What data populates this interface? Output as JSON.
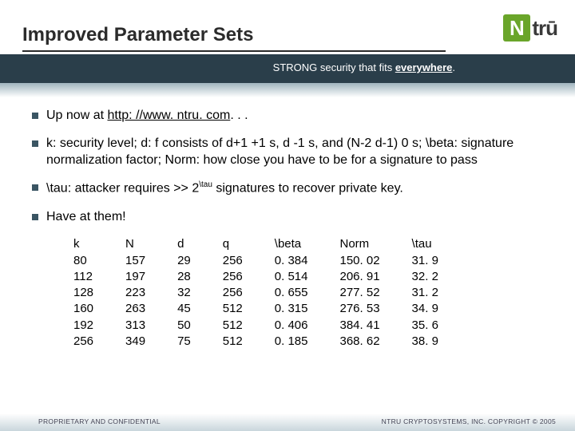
{
  "header": {
    "title": "Improved Parameter Sets",
    "tagline_pre": "STRONG security that fits ",
    "tagline_emph": "everywhere",
    "tagline_post": "."
  },
  "logo": {
    "mark": "N",
    "text": "trū"
  },
  "bullets": {
    "b1_pre": "Up now at ",
    "b1_link": "http: //www. ntru. com",
    "b1_post": ". . .",
    "b2": "k: security level; d: f consists of d+1 +1 s, d -1 s, and (N-2 d-1) 0 s; \\beta: signature normalization factor; Norm: how close you have to be for a signature to pass",
    "b3_pre": "\\tau: attacker requires >> 2",
    "b3_sup": "\\tau",
    "b3_post": " signatures to recover private key.",
    "b4": "Have at them!"
  },
  "table": {
    "headers": [
      "k",
      "N",
      "d",
      "q",
      "\\beta",
      "Norm",
      "\\tau"
    ],
    "rows": [
      [
        "80",
        "157",
        "29",
        "256",
        "0. 384",
        "150. 02",
        "31. 9"
      ],
      [
        "112",
        "197",
        "28",
        "256",
        "0. 514",
        "206. 91",
        "32. 2"
      ],
      [
        "128",
        "223",
        "32",
        "256",
        "0. 655",
        "277. 52",
        "31. 2"
      ],
      [
        "160",
        "263",
        "45",
        "512",
        "0. 315",
        "276. 53",
        "34. 9"
      ],
      [
        "192",
        "313",
        "50",
        "512",
        "0. 406",
        "384. 41",
        "35. 6"
      ],
      [
        "256",
        "349",
        "75",
        "512",
        "0. 185",
        "368. 62",
        "38. 9"
      ]
    ]
  },
  "footer": {
    "left": "PROPRIETARY AND CONFIDENTIAL",
    "right": "NTRU CRYPTOSYSTEMS, INC. COPYRIGHT © 2005"
  },
  "chart_data": {
    "type": "table",
    "title": "Improved Parameter Sets",
    "columns": [
      "k",
      "N",
      "d",
      "q",
      "\\beta",
      "Norm",
      "\\tau"
    ],
    "rows": [
      [
        80,
        157,
        29,
        256,
        0.384,
        150.02,
        31.9
      ],
      [
        112,
        197,
        28,
        256,
        0.514,
        206.91,
        32.2
      ],
      [
        128,
        223,
        32,
        256,
        0.655,
        277.52,
        31.2
      ],
      [
        160,
        263,
        45,
        512,
        0.315,
        276.53,
        34.9
      ],
      [
        192,
        313,
        50,
        512,
        0.406,
        384.41,
        35.6
      ],
      [
        256,
        349,
        75,
        512,
        0.185,
        368.62,
        38.9
      ]
    ]
  }
}
